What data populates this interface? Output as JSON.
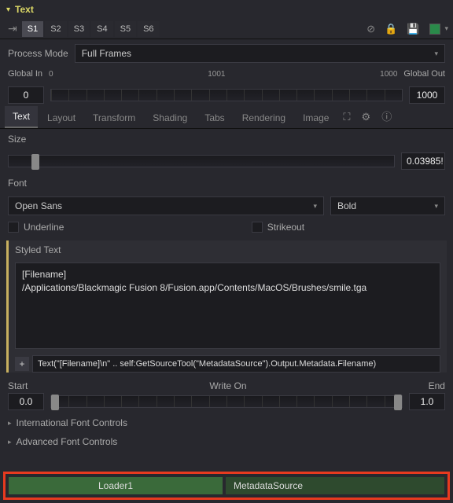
{
  "header": {
    "title": "Text"
  },
  "versions": {
    "items": [
      "S1",
      "S2",
      "S3",
      "S4",
      "S5",
      "S6"
    ],
    "active": 0
  },
  "toolbar_icons": {
    "a": "⊘",
    "b": "🔒",
    "c": "💾"
  },
  "swatch_color": "#2a8a4a",
  "process_mode": {
    "label": "Process Mode",
    "value": "Full Frames"
  },
  "range": {
    "global_in_label": "Global In",
    "global_out_label": "Global Out",
    "scale_start": "0",
    "scale_mid": "1001",
    "scale_end": "1000",
    "in_value": "0",
    "out_value": "1000"
  },
  "tabs": {
    "items": [
      "Text",
      "Layout",
      "Transform",
      "Shading",
      "Tabs",
      "Rendering",
      "Image"
    ],
    "active": 0,
    "icon_a": "⛶",
    "icon_b": "⚙",
    "icon_c": "ⓘ"
  },
  "size": {
    "label": "Size",
    "value": "0.03985!"
  },
  "font": {
    "label": "Font",
    "family": "Open Sans",
    "weight": "Bold",
    "underline": "Underline",
    "strikeout": "Strikeout"
  },
  "styled": {
    "label": "Styled Text",
    "line1": "[Filename]",
    "line2": "/Applications/Blackmagic Fusion 8/Fusion.app/Contents/MacOS/Brushes/smile.tga"
  },
  "expression": {
    "text": "Text(\"[Filename]\\n\" .. self:GetSourceTool(\"MetadataSource\").Output.Metadata.Filename)"
  },
  "writeon": {
    "start_label": "Start",
    "end_label": "End",
    "title": "Write On",
    "start": "0.0",
    "end": "1.0"
  },
  "collapsibles": {
    "intl": "International Font Controls",
    "adv": "Advanced Font Controls"
  },
  "footer": {
    "left": "Loader1",
    "right": "MetadataSource"
  }
}
